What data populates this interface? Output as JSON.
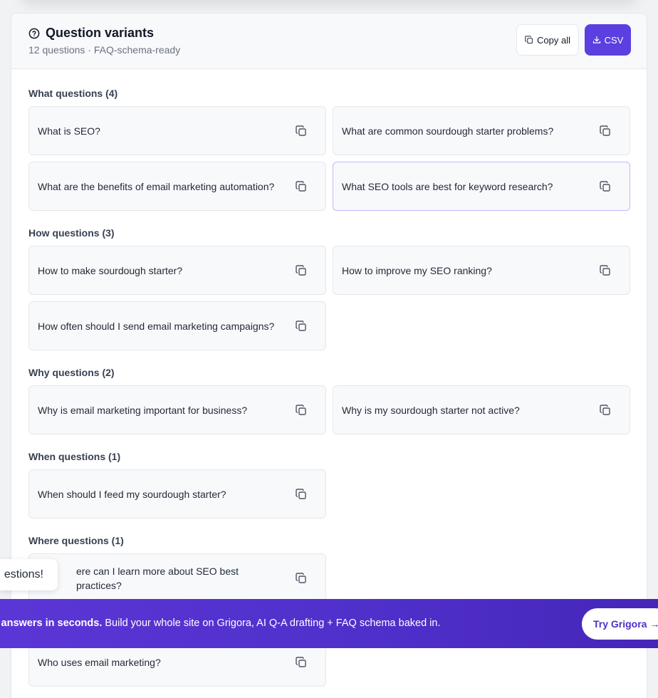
{
  "panel": {
    "title": "Question variants",
    "subtitle": "12 questions · FAQ-schema-ready",
    "copy_all_label": "Copy all",
    "csv_label": "CSV"
  },
  "sections": [
    {
      "label": "What questions (4)",
      "items": [
        "What is SEO?",
        "What are common sourdough starter problems?",
        "What are the benefits of email marketing automation?",
        "What SEO tools are best for keyword research?"
      ]
    },
    {
      "label": "How questions (3)",
      "items": [
        "How to make sourdough starter?",
        "How to improve my SEO ranking?",
        "How often should I send email marketing campaigns?"
      ]
    },
    {
      "label": "Why questions (2)",
      "items": [
        "Why is email marketing important for business?",
        "Why is my sourdough starter not active?"
      ]
    },
    {
      "label": "When questions (1)",
      "items": [
        "When should I feed my sourdough starter?"
      ]
    },
    {
      "label": "Where questions (1)",
      "items": [
        "ere can I learn more about SEO best practices?"
      ]
    },
    {
      "label": "",
      "items": [
        "Who uses email marketing?"
      ]
    }
  ],
  "toast": {
    "text": "estions!"
  },
  "banner": {
    "bold_text": "ft FAQ answers in seconds.",
    "text": " Build your whole site on Grigora, AI Q-A drafting + FAQ schema baked in.",
    "cta_label": "Try Grigora →"
  },
  "colors": {
    "accent": "#5b3fe0",
    "banner": "#5b36d6",
    "card_bg": "#f8f9fb",
    "border": "#e5e7eb"
  },
  "icons": {
    "header": "question-circle-icon",
    "copy": "copy-icon",
    "download": "download-icon"
  }
}
